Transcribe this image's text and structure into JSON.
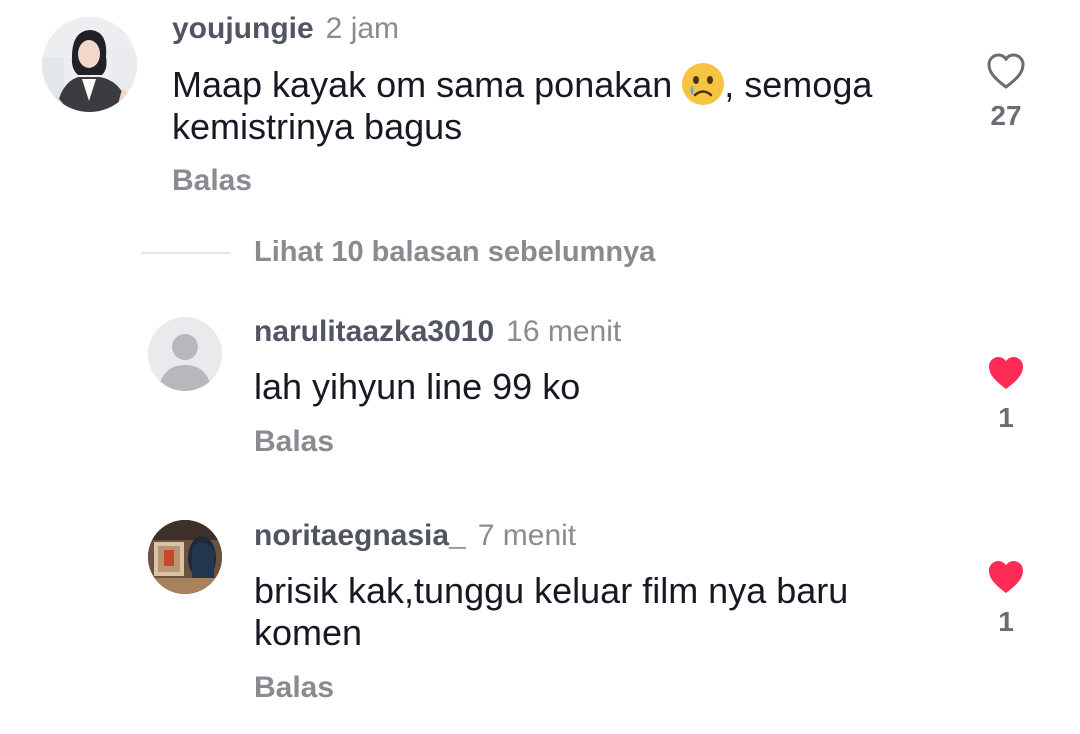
{
  "comments": [
    {
      "username": "youjungie",
      "time": "2 jam",
      "text_before_emoji": "Maap kayak om sama ponakan ",
      "emoji": "crying-face-emoji",
      "text_after_emoji": ", semoga kemistrinya bagus",
      "reply_label": "Balas",
      "likes": "27",
      "liked": false
    },
    {
      "username": "narulitaazka3010",
      "time": "16 menit",
      "text": "lah yihyun line 99 ko",
      "reply_label": "Balas",
      "likes": "1",
      "liked": true
    },
    {
      "username": "noritaegnasia_",
      "time": "7 menit",
      "text": "brisik kak,tunggu keluar film nya baru komen",
      "reply_label": "Balas",
      "likes": "1",
      "liked": true
    }
  ],
  "view_more_replies": "Lihat 10 balasan sebelumnya",
  "colors": {
    "like_active": "#fe2c55",
    "like_inactive": "#6b6d75",
    "secondary_text": "#8a8b91"
  }
}
